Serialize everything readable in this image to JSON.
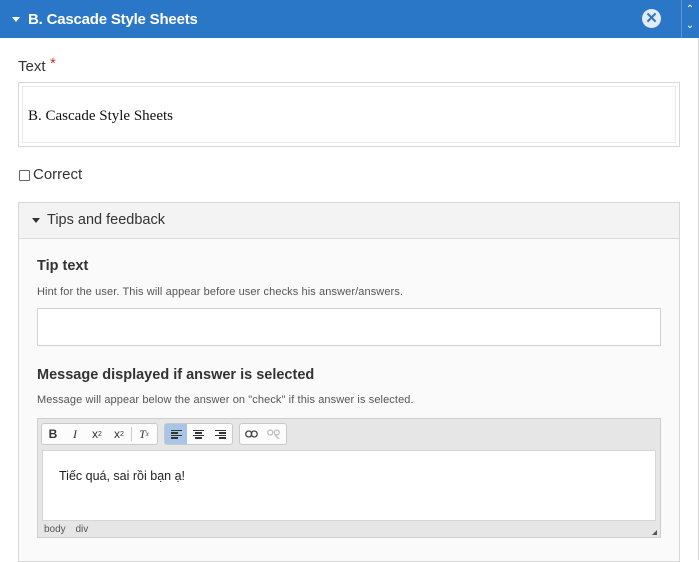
{
  "header": {
    "title": "B. Cascade Style Sheets"
  },
  "text_field": {
    "label": "Text",
    "required_mark": "*",
    "value": "B. Cascade Style Sheets"
  },
  "correct": {
    "label": "Correct",
    "checked": false
  },
  "tips": {
    "title": "Tips and feedback",
    "tip_text": {
      "label": "Tip text",
      "hint": "Hint for the user. This will appear before user checks his answer/answers.",
      "value": ""
    },
    "message": {
      "label": "Message displayed if answer is selected",
      "hint": "Message will appear below the answer on \"check\" if this answer is selected.",
      "toolbar": {
        "bold": "B",
        "italic": "I",
        "subscript": "x",
        "superscript": "x",
        "remove_format": "T",
        "active_align": "align-left"
      },
      "content": "Tiếc quá, sai rồi bạn ạ!",
      "elements_path": [
        "body",
        "div"
      ]
    }
  },
  "icons": {
    "close": "close-circle-icon",
    "collapse": "caret-down-icon",
    "scroll_up": "chevron-up-icon",
    "scroll_down": "chevron-down-icon"
  },
  "colors": {
    "header_bg": "#2b77c7",
    "required": "#d12f2f",
    "active_tool": "#a8c5e8"
  }
}
